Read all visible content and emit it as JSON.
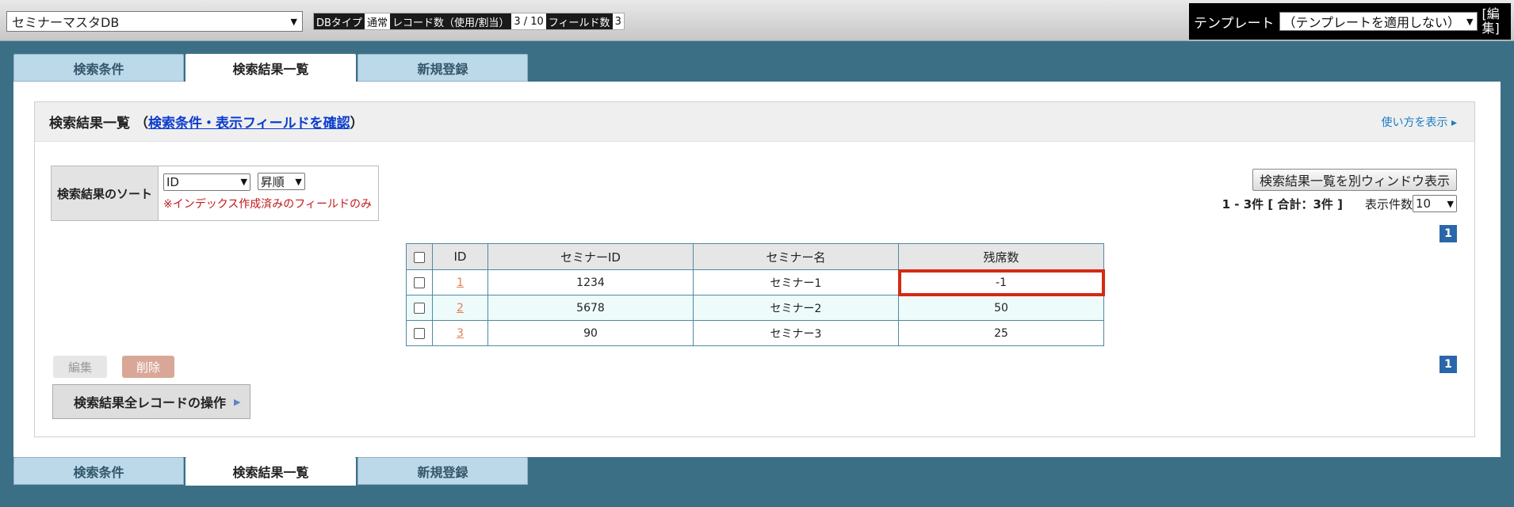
{
  "topbar": {
    "db_select_value": "セミナーマスタDB",
    "info": [
      {
        "key": "DBタイプ",
        "value": "通常"
      },
      {
        "key": "レコード数（使用/割当）",
        "value": "3 / 10"
      },
      {
        "key": "フィールド数",
        "value": "3"
      }
    ],
    "template_label": "テンプレート",
    "template_value": "（テンプレートを適用しない）",
    "template_edit": "[編集]"
  },
  "tabs": [
    {
      "label": "検索条件",
      "active": false
    },
    {
      "label": "検索結果一覧",
      "active": true
    },
    {
      "label": "新規登録",
      "active": false
    }
  ],
  "panel": {
    "title": "検索結果一覧",
    "title_paren_open": "（",
    "title_link": "検索条件・表示フィールドを確認",
    "title_paren_close": "）",
    "usage_link": "使い方を表示 ▸",
    "sort": {
      "label": "検索結果のソート",
      "field": "ID",
      "order": "昇順",
      "note": "※インデックス作成済みのフィールドのみ"
    },
    "popup_button": "検索結果一覧を別ウィンドウ表示",
    "count_text": "1 - 3件 [ 合計：3件 ]",
    "per_page_label": "表示件数",
    "per_page_value": "10",
    "page_number": "1",
    "table": {
      "headers": [
        "ID",
        "セミナーID",
        "セミナー名",
        "残席数"
      ],
      "rows": [
        {
          "id": "1",
          "seminar_id": "1234",
          "name": "セミナー1",
          "seats": "-1"
        },
        {
          "id": "2",
          "seminar_id": "5678",
          "name": "セミナー2",
          "seats": "50"
        },
        {
          "id": "3",
          "seminar_id": "90",
          "name": "セミナー3",
          "seats": "25"
        }
      ]
    },
    "edit_button": "編集",
    "delete_button": "削除",
    "all_ops": "検索結果全レコードの操作",
    "colors": {
      "accent": "#3b6f86",
      "highlight": "#d52a12",
      "page_badge": "#2a67aa"
    }
  }
}
